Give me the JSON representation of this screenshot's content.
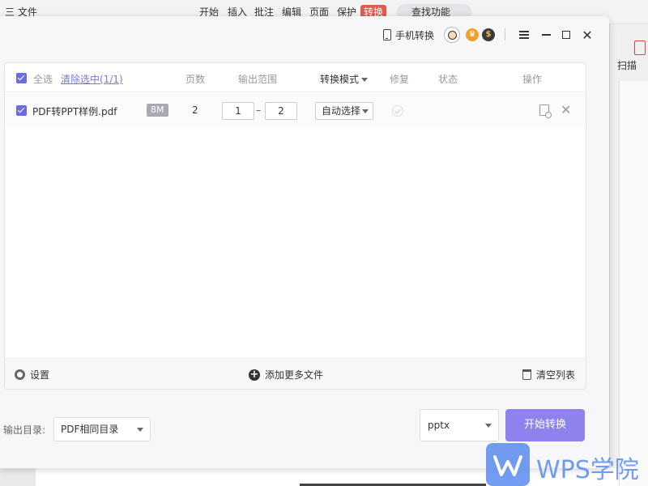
{
  "background_app": {
    "menu_file": "三 文件",
    "tabs": [
      "开始",
      "插入",
      "批注",
      "编辑",
      "页面",
      "保护",
      "转换"
    ],
    "search": "查找功能",
    "scan_label": "扫描"
  },
  "titlebar": {
    "phone_convert": "手机转换"
  },
  "table": {
    "select_all": "全选",
    "clear_selection": "清除选中(1/1)",
    "col_pages": "页数",
    "col_range": "输出范围",
    "col_mode": "转换模式",
    "col_repair": "修复",
    "col_status": "状态",
    "col_actions": "操作",
    "rows": [
      {
        "filename": "PDF转PPT样例.pdf",
        "size": "8M",
        "pages": "2",
        "range_from": "1",
        "range_to": "2",
        "mode": "自动选择"
      }
    ],
    "range_separator": "–"
  },
  "footer": {
    "settings": "设置",
    "add_more": "添加更多文件",
    "clear_list": "清空列表"
  },
  "bottom": {
    "output_dir_label": "输出目录:",
    "output_dir_value": "PDF相同目录",
    "format": "pptx",
    "start_button": "开始转换"
  },
  "watermark": {
    "text": "WPS学院"
  },
  "colors": {
    "accent": "#8e82ef",
    "checkbox": "#6c6ce0",
    "active_tab": "#e45a4e",
    "watermark": "#5a8cf0"
  }
}
